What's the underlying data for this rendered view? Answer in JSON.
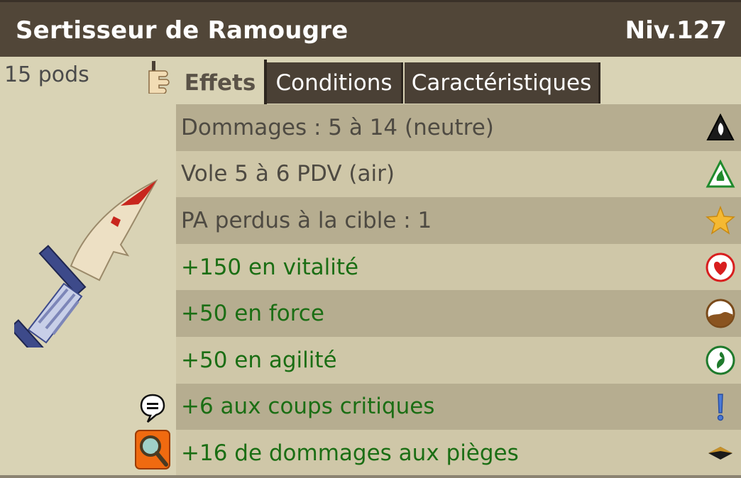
{
  "item": {
    "name": "Sertisseur de Ramougre",
    "level": "Niv.127",
    "weight": "15 pods"
  },
  "tabs": [
    {
      "label": "Effets",
      "active": true
    },
    {
      "label": "Conditions",
      "active": false
    },
    {
      "label": "Caractéristiques",
      "active": false
    }
  ],
  "effects": [
    {
      "text": "Dommages : 5 à 14 (neutre)",
      "icon": "neutral-element-icon",
      "color": "grey"
    },
    {
      "text": "Vole 5 à 6 PDV (air)",
      "icon": "air-element-icon",
      "color": "grey"
    },
    {
      "text": "PA perdus à la cible : 1",
      "icon": "star-icon",
      "color": "grey"
    },
    {
      "text": "+150 en vitalité",
      "icon": "heart-icon",
      "color": "green"
    },
    {
      "text": "+50 en force",
      "icon": "earth-strength-icon",
      "color": "green"
    },
    {
      "text": "+50 en agilité",
      "icon": "agility-icon",
      "color": "green"
    },
    {
      "text": "+6 aux coups critiques",
      "icon": "exclamation-icon",
      "color": "green"
    },
    {
      "text": "+16 de dommages aux pièges",
      "icon": "trap-icon",
      "color": "green"
    }
  ],
  "colors": {
    "header_bg": "#514638",
    "panel_bg": "#d9d3b5",
    "row_dark": "#b6ad90",
    "row_light": "#cfc7a8",
    "bonus_text": "#1b6e14",
    "base_text": "#4e4a42"
  }
}
